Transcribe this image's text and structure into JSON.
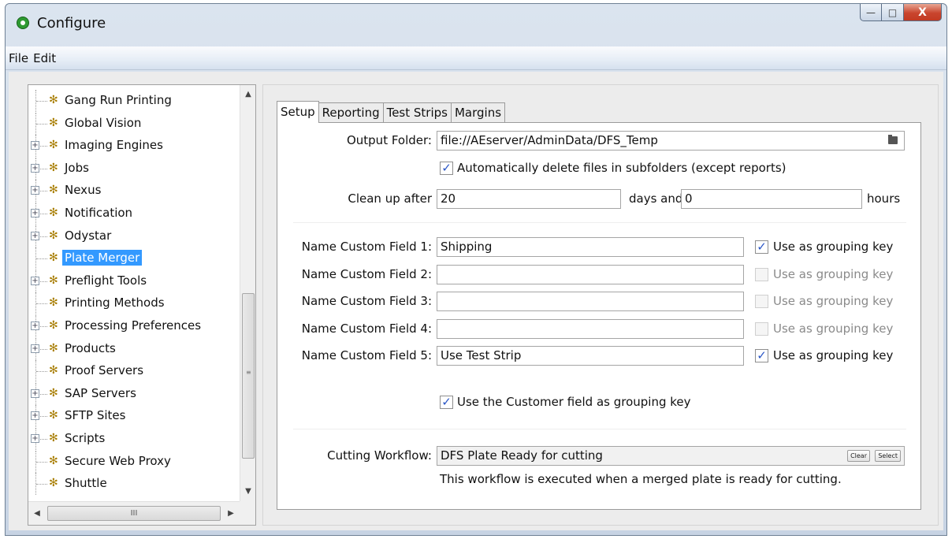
{
  "window": {
    "title": "Configure",
    "minimize_glyph": "—",
    "maximize_glyph": "□",
    "close_glyph": "X"
  },
  "menu": [
    "File",
    "Edit"
  ],
  "tree": {
    "items": [
      {
        "label": "Gang Run Printing",
        "expandable": false,
        "selected": false
      },
      {
        "label": "Global Vision",
        "expandable": false,
        "selected": false
      },
      {
        "label": "Imaging Engines",
        "expandable": true,
        "selected": false
      },
      {
        "label": "Jobs",
        "expandable": true,
        "selected": false
      },
      {
        "label": "Nexus",
        "expandable": true,
        "selected": false
      },
      {
        "label": "Notification",
        "expandable": true,
        "selected": false
      },
      {
        "label": "Odystar",
        "expandable": true,
        "selected": false
      },
      {
        "label": "Plate Merger",
        "expandable": false,
        "selected": true
      },
      {
        "label": "Preflight Tools",
        "expandable": true,
        "selected": false
      },
      {
        "label": "Printing Methods",
        "expandable": false,
        "selected": false
      },
      {
        "label": "Processing Preferences",
        "expandable": true,
        "selected": false
      },
      {
        "label": "Products",
        "expandable": true,
        "selected": false
      },
      {
        "label": "Proof Servers",
        "expandable": false,
        "selected": false
      },
      {
        "label": "SAP Servers",
        "expandable": true,
        "selected": false
      },
      {
        "label": "SFTP Sites",
        "expandable": true,
        "selected": false
      },
      {
        "label": "Scripts",
        "expandable": true,
        "selected": false
      },
      {
        "label": "Secure Web Proxy",
        "expandable": false,
        "selected": false
      },
      {
        "label": "Shuttle",
        "expandable": false,
        "selected": false
      }
    ],
    "scroll_grip": "III"
  },
  "tabs": [
    {
      "label": "Setup",
      "active": true
    },
    {
      "label": "Reporting",
      "active": false
    },
    {
      "label": "Test Strips",
      "active": false
    },
    {
      "label": "Margins",
      "active": false
    }
  ],
  "setup": {
    "output_folder_label": "Output Folder:",
    "output_folder_value": "file://AEserver/AdminData/DFS_Temp",
    "auto_delete_label": "Automatically delete files in subfolders (except reports)",
    "auto_delete_checked": true,
    "cleanup_label": "Clean up after",
    "cleanup_days": "20",
    "days_and_label": "days and",
    "cleanup_hours": "0",
    "hours_label": "hours",
    "custom_fields": [
      {
        "label": "Name Custom Field 1:",
        "value": "Shipping",
        "grouping_checked": true,
        "grouping_enabled": true
      },
      {
        "label": "Name Custom Field 2:",
        "value": "",
        "grouping_checked": false,
        "grouping_enabled": false
      },
      {
        "label": "Name Custom Field 3:",
        "value": "",
        "grouping_checked": false,
        "grouping_enabled": false
      },
      {
        "label": "Name Custom Field 4:",
        "value": "",
        "grouping_checked": false,
        "grouping_enabled": false
      },
      {
        "label": "Name Custom Field 5:",
        "value": "Use Test Strip",
        "grouping_checked": true,
        "grouping_enabled": true
      }
    ],
    "grouping_key_label": "Use as grouping key",
    "customer_grouping_label": "Use the Customer field as grouping key",
    "customer_grouping_checked": true,
    "cutting_workflow_label": "Cutting Workflow:",
    "cutting_workflow_value": "DFS Plate Ready for cutting",
    "clear_label": "Clear",
    "select_label": "Select",
    "cutting_note": "This workflow is executed when a merged plate is ready for cutting."
  },
  "colors": {
    "selection": "#3399ff",
    "check": "#2a56c6",
    "gear": "#a87d00",
    "close_button": "#c9452e"
  }
}
